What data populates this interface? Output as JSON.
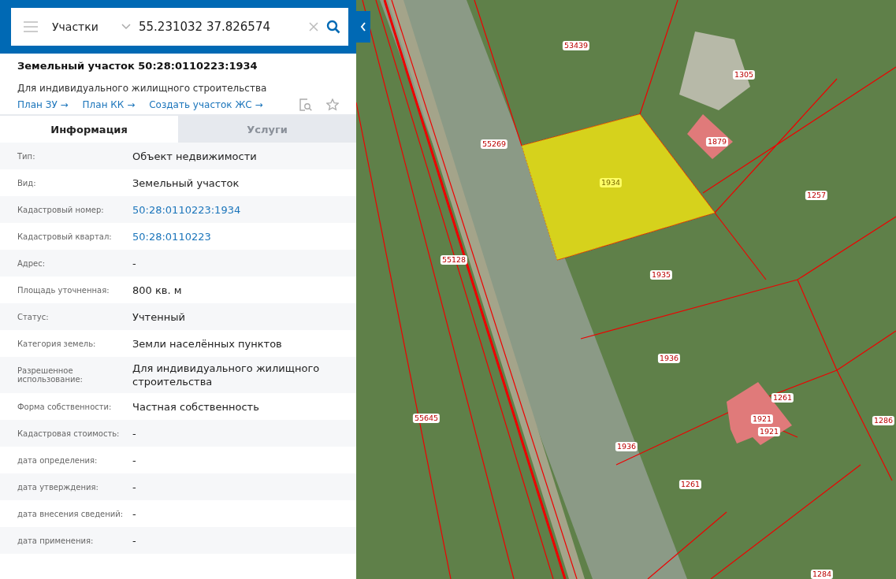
{
  "search": {
    "layer": "Участки",
    "query": "55.231032 37.826574"
  },
  "object": {
    "title": "Земельный участок 50:28:0110223:1934",
    "subtitle": "Для индивидуального жилищного строительства",
    "links": [
      "План ЗУ →",
      "План КК →",
      "Создать участок ЖС →"
    ]
  },
  "tabs": [
    {
      "label": "Информация",
      "selected": true
    },
    {
      "label": "Услуги",
      "selected": false
    }
  ],
  "rows": [
    {
      "label": "Тип:",
      "value": "Объект недвижимости",
      "kind": "text"
    },
    {
      "label": "Вид:",
      "value": "Земельный участок",
      "kind": "text"
    },
    {
      "label": "Кадастровый номер:",
      "value": "50:28:0110223:1934",
      "kind": "link"
    },
    {
      "label": "Кадастровый квартал:",
      "value": "50:28:0110223",
      "kind": "link"
    },
    {
      "label": "Адрес:",
      "value": "-",
      "kind": "text"
    },
    {
      "label": "Площадь уточненная:",
      "value": "800 кв. м",
      "kind": "text"
    },
    {
      "label": "Статус:",
      "value": "Учтенный",
      "kind": "text"
    },
    {
      "label": "Категория земель:",
      "value": "Земли населённых пунктов",
      "kind": "text"
    },
    {
      "label": "Разрешенное использование:",
      "value": "Для индивидуального жилищного строительства",
      "kind": "text"
    },
    {
      "label": "Форма собственности:",
      "value": "Частная собственность",
      "kind": "text"
    },
    {
      "label": "Кадастровая стоимость:",
      "value": "-",
      "kind": "text"
    },
    {
      "label": "дата определения:",
      "value": "-",
      "kind": "text"
    },
    {
      "label": "дата утверждения:",
      "value": "-",
      "kind": "text"
    },
    {
      "label": "дата внесения сведений:",
      "value": "-",
      "kind": "text"
    },
    {
      "label": "дата применения:",
      "value": "-",
      "kind": "text"
    }
  ],
  "map": {
    "parcels": [
      {
        "label": "53439",
        "selected": false
      },
      {
        "label": "1305",
        "selected": false
      },
      {
        "label": "55269",
        "selected": false
      },
      {
        "label": "1879",
        "selected": false
      },
      {
        "label": "1934",
        "selected": true
      },
      {
        "label": "1257",
        "selected": false
      },
      {
        "label": "55128",
        "selected": false
      },
      {
        "label": "1935",
        "selected": false
      },
      {
        "label": "1936",
        "selected": false
      },
      {
        "label": "1261",
        "selected": false
      },
      {
        "label": "1921",
        "selected": false
      },
      {
        "label": "1921",
        "selected": false
      },
      {
        "label": "55645",
        "selected": false
      },
      {
        "label": "1286",
        "selected": false
      },
      {
        "label": "1936",
        "selected": false
      },
      {
        "label": "1261",
        "selected": false
      },
      {
        "label": "1284",
        "selected": false
      }
    ]
  }
}
